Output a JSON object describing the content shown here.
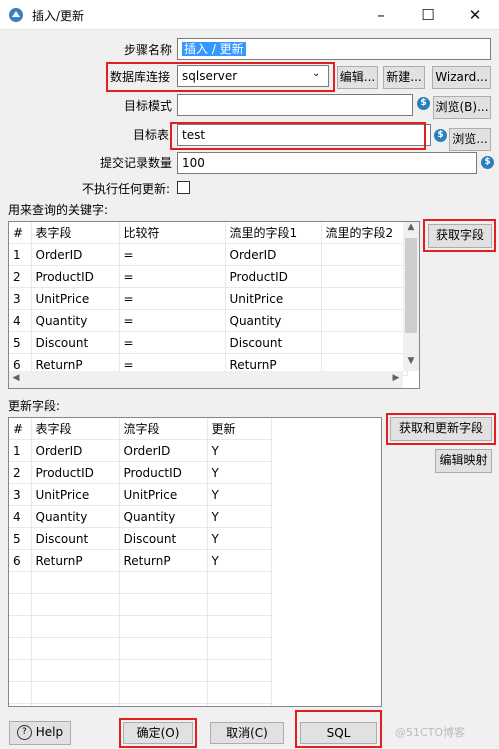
{
  "window": {
    "title": "插入/更新"
  },
  "form": {
    "step_name_label": "步骤名称",
    "step_name_value": "插入 / 更新",
    "db_connection_label": "数据库连接",
    "db_connection_value": "sqlserver",
    "edit_button": "编辑...",
    "new_button": "新建...",
    "wizard_button": "Wizard...",
    "target_schema_label": "目标模式",
    "target_schema_value": "",
    "browse_schema_button": "浏览(B)...",
    "target_table_label": "目标表",
    "target_table_value": "test",
    "browse_table_button": "浏览...",
    "commit_size_label": "提交记录数量",
    "commit_size_value": "100",
    "no_update_label": "不执行任何更新:"
  },
  "keys": {
    "section_label": "用来查询的关键字:",
    "columns": [
      "#",
      "表字段",
      "比较符",
      "流里的字段1",
      "流里的字段2"
    ],
    "rows": [
      [
        "1",
        "OrderID",
        "=",
        "OrderID",
        ""
      ],
      [
        "2",
        "ProductID",
        "=",
        "ProductID",
        ""
      ],
      [
        "3",
        "UnitPrice",
        "=",
        "UnitPrice",
        ""
      ],
      [
        "4",
        "Quantity",
        "=",
        "Quantity",
        ""
      ],
      [
        "5",
        "Discount",
        "=",
        "Discount",
        ""
      ],
      [
        "6",
        "ReturnP",
        "=",
        "ReturnP",
        ""
      ]
    ],
    "get_fields_button": "获取字段"
  },
  "updates": {
    "section_label": "更新字段:",
    "columns": [
      "#",
      "表字段",
      "流字段",
      "更新"
    ],
    "rows": [
      [
        "1",
        "OrderID",
        "OrderID",
        "Y"
      ],
      [
        "2",
        "ProductID",
        "ProductID",
        "Y"
      ],
      [
        "3",
        "UnitPrice",
        "UnitPrice",
        "Y"
      ],
      [
        "4",
        "Quantity",
        "Quantity",
        "Y"
      ],
      [
        "5",
        "Discount",
        "Discount",
        "Y"
      ],
      [
        "6",
        "ReturnP",
        "ReturnP",
        "Y"
      ]
    ],
    "get_update_fields_button": "获取和更新字段",
    "edit_mapping_button": "编辑映射"
  },
  "footer": {
    "help_button": "Help",
    "ok_button": "确定(O)",
    "cancel_button": "取消(C)",
    "sql_button": "SQL",
    "watermark": "@51CTO博客"
  },
  "icons": {
    "app": "spoon-icon",
    "variable": "dollar-variable-icon"
  },
  "colors": {
    "highlight_red": "#e02020",
    "selection_blue": "#3399ff"
  }
}
